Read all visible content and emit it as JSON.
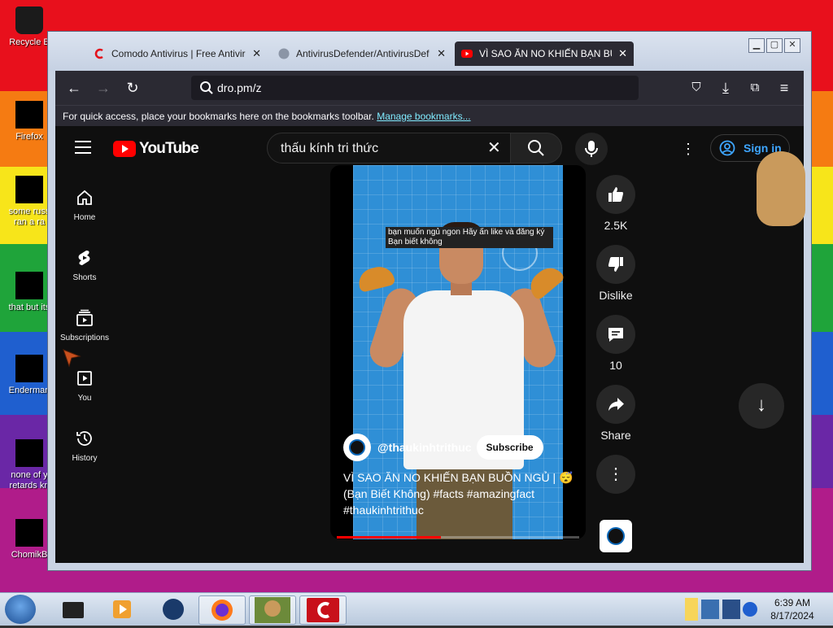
{
  "desktop": {
    "icons": [
      {
        "label": "Recycle B"
      },
      {
        "label": "Firefox"
      },
      {
        "label": "some russ"
      },
      {
        "label": "ran a ra"
      },
      {
        "label": "that but its"
      },
      {
        "label": "Enderman"
      },
      {
        "label": "none of y"
      },
      {
        "label": "retards kn"
      },
      {
        "label": "ChomikB"
      }
    ]
  },
  "browser": {
    "tabs": [
      {
        "title": "Comodo Antivirus | Free Antivir",
        "icon": "comodo-icon",
        "active": false
      },
      {
        "title": "AntivirusDefender/AntivirusDef",
        "icon": "github-icon",
        "active": false
      },
      {
        "title": "VÌ SAO ĂN NO KHIẾN BẠN BUỒ",
        "icon": "youtube-icon",
        "active": true
      }
    ],
    "url": "dro.pm/z",
    "bookmarks_hint": "For quick access, place your bookmarks here on the bookmarks toolbar.",
    "bookmarks_link": "Manage bookmarks..."
  },
  "youtube": {
    "logo_text": "YouTube",
    "search_query": "thấu kính tri thức",
    "sign_in": "Sign in",
    "guide": [
      {
        "label": "Home",
        "icon": "home-icon"
      },
      {
        "label": "Shorts",
        "icon": "shorts-icon"
      },
      {
        "label": "Subscriptions",
        "icon": "subscriptions-icon"
      },
      {
        "label": "You",
        "icon": "you-icon"
      },
      {
        "label": "History",
        "icon": "history-icon"
      }
    ],
    "short": {
      "caption_line1": "bạn muốn ngủ ngon Hãy ấn like và đăng ký",
      "caption_line2": "Bạn biết không",
      "channel": "@thaukinhtrithuc",
      "subscribe": "Subscribe",
      "title": "VÌ SAO ĂN NO KHIẾN BẠN BUỒN NGỦ | 😴 (Bạn Biết Không) #facts #amazingfact #thaukinhtrithuc",
      "progress": 0.43
    },
    "actions": {
      "like_count": "2.5K",
      "dislike": "Dislike",
      "comments": "10",
      "share": "Share"
    }
  },
  "taskbar": {
    "time": "6:39 AM",
    "date": "8/17/2024"
  }
}
